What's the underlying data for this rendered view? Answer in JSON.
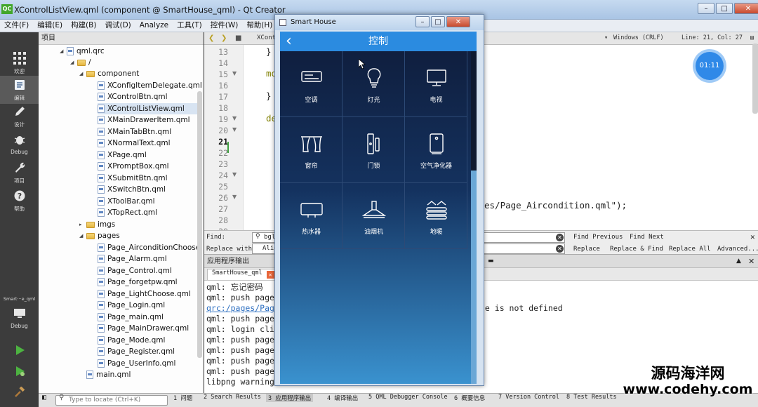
{
  "window": {
    "logo": "QC",
    "title": "XControlListView.qml (component @ SmartHouse_qml) - Qt Creator",
    "minimize": "–",
    "maximize": "□",
    "close": "✕"
  },
  "menu": [
    "文件(F)",
    "编辑(E)",
    "构建(B)",
    "调试(D)",
    "Analyze",
    "工具(T)",
    "控件(W)",
    "帮助(H)"
  ],
  "modes": {
    "welcome": "欢迎",
    "edit": "编辑",
    "design": "设计",
    "debug": "Debug",
    "projects": "项目",
    "help": "帮助",
    "kit_name": "Smart···e_qml",
    "kit_mode": "Debug"
  },
  "project_panel": {
    "title": "项目",
    "root": "qml.qrc",
    "slash": "/",
    "component": "component",
    "component_files": [
      "XConfigItemDelegate.qml",
      "XControlBtn.qml",
      "XControlListView.qml",
      "XMainDrawerItem.qml",
      "XMainTabBtn.qml",
      "XNormalText.qml",
      "XPage.qml",
      "XPromptBox.qml",
      "XSubmitBtn.qml",
      "XSwitchBtn.qml",
      "XToolBar.qml",
      "XTopRect.qml"
    ],
    "imgs": "imgs",
    "pages": "pages",
    "pages_files": [
      "Page_AirconditionChoose.",
      "Page_Alarm.qml",
      "Page_Control.qml",
      "Page_forgetpw.qml",
      "Page_LightChoose.qml",
      "Page_Login.qml",
      "Page_main.qml",
      "Page_MainDrawer.qml",
      "Page_Mode.qml",
      "Page_Register.qml",
      "Page_UserInfo.qml"
    ],
    "main": "main.qml"
  },
  "editor": {
    "file_tab": "XCont",
    "encoding": "Windows (CRLF)",
    "position": "Line: 21, Col: 27",
    "line_numbers": [
      "13",
      "14",
      "15",
      "16",
      "17",
      "18",
      "19",
      "20",
      "21",
      "22",
      "23",
      "24",
      "25",
      "26",
      "27",
      "28",
      "29"
    ],
    "lines": [
      "}",
      "mo",
      "",
      "}",
      "",
      "de",
      "",
      "",
      "",
      "",
      "",
      "",
      "",
      "",
      "es/Page_Aircondition.qml\");",
      "",
      ""
    ],
    "timer": "01:11"
  },
  "find": {
    "find_label": "Find:",
    "find_value": "bgl",
    "replace_label": "Replace with:",
    "replace_value": "AlignLe",
    "find_previous": "Find Previous",
    "find_next": "Find Next",
    "replace": "Replace",
    "replace_find": "Replace & Find",
    "replace_all": "Replace All",
    "advanced": "Advanced..."
  },
  "output": {
    "title": "应用程序输出",
    "tab": "SmartHouse_qml",
    "lines": [
      "qml: 忘记密码",
      "qml: push page",
      "qrc:/pages/Pag",
      "qml: push page",
      "qml: login cli",
      "qml: push page",
      "qml: push page",
      "qml: push page",
      "qml: push page",
      "libpng warning"
    ],
    "tail": "ge is not defined"
  },
  "statusbar": {
    "locate_placeholder": "Type to locate (Ctrl+K)",
    "tabs": [
      "1 问题",
      "2 Search Results",
      "3 应用程序输出",
      "4 编译输出",
      "5 QML Debugger Console",
      "6 概要信息",
      "7 Version Control",
      "8 Test Results"
    ]
  },
  "phone": {
    "window_title": "Smart House",
    "header_title": "控制",
    "back": "‹",
    "devices": [
      {
        "label": "空调",
        "icon": "air-conditioner-icon"
      },
      {
        "label": "灯光",
        "icon": "light-bulb-icon"
      },
      {
        "label": "电视",
        "icon": "tv-icon"
      },
      {
        "label": "窗帘",
        "icon": "curtain-icon"
      },
      {
        "label": "门锁",
        "icon": "door-lock-icon"
      },
      {
        "label": "空气净化器",
        "icon": "air-purifier-icon"
      },
      {
        "label": "热水器",
        "icon": "water-heater-icon"
      },
      {
        "label": "油烟机",
        "icon": "range-hood-icon"
      },
      {
        "label": "地暖",
        "icon": "floor-heating-icon"
      }
    ]
  },
  "watermark": {
    "line1": "源码海洋网",
    "line2": "www.codehy.com"
  }
}
